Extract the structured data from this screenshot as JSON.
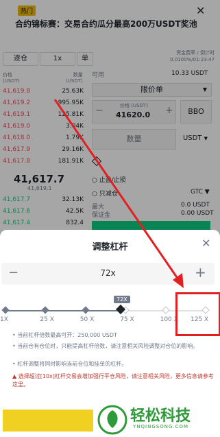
{
  "banner": {
    "badge": "热门",
    "text": "合约锦标赛：交易合约瓜分最高200万USDT奖池",
    "close_icon": "close-icon"
  },
  "toolbar": {
    "mode": "逐仓",
    "leverage": "1x",
    "side": "单"
  },
  "funding": {
    "line1": "资金费率 / 倒计时",
    "line2": "0.0100%/01:23:47"
  },
  "orderbook": {
    "price_header": "价格",
    "price_unit": "(USDT)",
    "qty_header": "数量",
    "qty_unit": "(USDT)",
    "asks": [
      {
        "price": "41,619.8",
        "qty": "25.63K"
      },
      {
        "price": "41,619.2",
        "qty": "995.95K"
      },
      {
        "price": "41,619.1",
        "qty": "125.81K"
      },
      {
        "price": "41,619.0",
        "qty": "3.04K"
      },
      {
        "price": "41,618.0",
        "qty": "1.79K"
      },
      {
        "price": "41,617.9",
        "qty": "29.16K"
      },
      {
        "price": "41,617.8",
        "qty": "181.91K"
      }
    ],
    "mid_price": "41,617.7",
    "mid_sub": "41,619.1",
    "bids": [
      {
        "price": "41,617.7",
        "qty": "32.13K"
      },
      {
        "price": "41,617.6",
        "qty": "42.5K"
      },
      {
        "price": "41,617.4",
        "qty": "832.4"
      }
    ]
  },
  "order_form": {
    "available_label": "可用",
    "available_value": "10.33 USDT",
    "order_type": "限价单",
    "price_label": "价格 (USDT)",
    "price_value": "41620.0",
    "bbo_label": "BBO",
    "quantity_placeholder": "数量",
    "quantity_unit": "USDT",
    "tp_sl": "止盈/止损",
    "reduce_only": "只减仓",
    "tif": "GTC",
    "max_label": "最大",
    "max_value": "0.0 USDT",
    "margin_label": "保证金",
    "margin_value": "0.00 USDT"
  },
  "modal": {
    "title": "调整杠杆",
    "leverage_value": "72x",
    "tooltip": "72X",
    "ticks": [
      "1X",
      "25 X",
      "50 X",
      "75 X",
      "100 X",
      "125 X"
    ],
    "slider_level": 0.576,
    "notes": [
      "当前杠杆倍数最高可开：250,000 USDT",
      "当前仓有仓位时，只能提高杠杆倍数，请注意相关风险调整对仓位的影响。",
      "杠杆调整将同时影响当前仓位和挂单的杠杆。"
    ],
    "warning": "选择超过[10x]杠杆交易会增加强行平仓风险，请注意相关风险，更多信息请参考这里。"
  },
  "watermark": {
    "text": "轻松科技",
    "sub": "YNQINGSONG.COM"
  },
  "colors": {
    "ask": "#f6465d",
    "bid": "#0ecb81",
    "accent": "#f0b90b",
    "highlight": "#e02020"
  }
}
